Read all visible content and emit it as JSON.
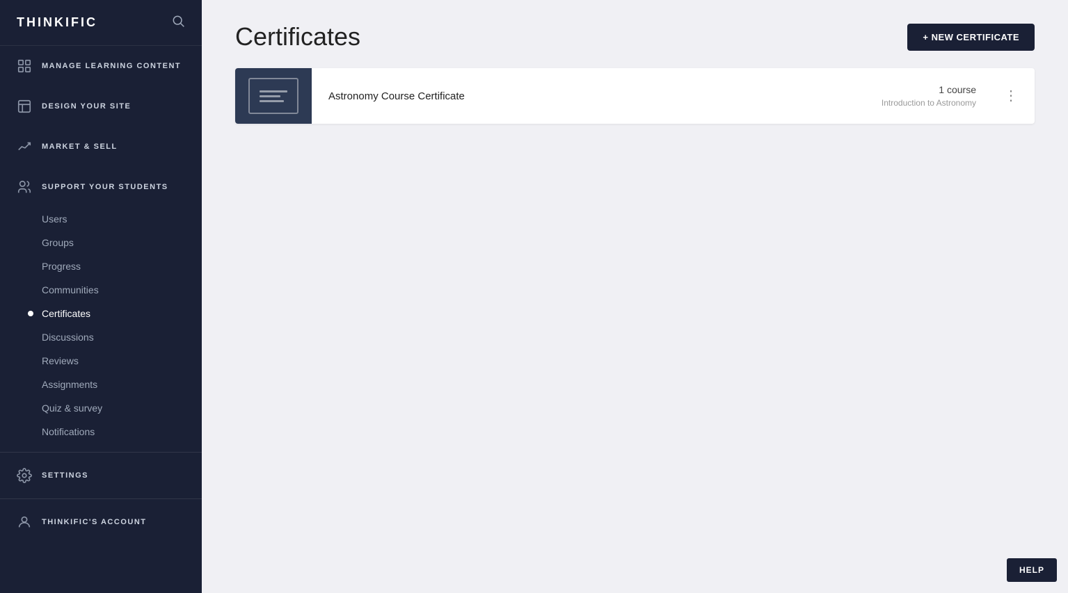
{
  "app": {
    "logo": "THINKIFIC"
  },
  "sidebar": {
    "sections": [
      {
        "id": "manage",
        "label": "MANAGE LEARNING CONTENT",
        "icon": "grid-icon",
        "subitems": []
      },
      {
        "id": "design",
        "label": "DESIGN YOUR SITE",
        "icon": "layout-icon",
        "subitems": []
      },
      {
        "id": "market",
        "label": "MARKET & SELL",
        "icon": "chart-icon",
        "subitems": []
      },
      {
        "id": "support",
        "label": "SUPPORT YOUR STUDENTS",
        "icon": "users-icon",
        "subitems": [
          {
            "id": "users",
            "label": "Users",
            "active": false
          },
          {
            "id": "groups",
            "label": "Groups",
            "active": false
          },
          {
            "id": "progress",
            "label": "Progress",
            "active": false
          },
          {
            "id": "communities",
            "label": "Communities",
            "active": false
          },
          {
            "id": "certificates",
            "label": "Certificates",
            "active": true
          },
          {
            "id": "discussions",
            "label": "Discussions",
            "active": false
          },
          {
            "id": "reviews",
            "label": "Reviews",
            "active": false
          },
          {
            "id": "assignments",
            "label": "Assignments",
            "active": false
          },
          {
            "id": "quiz-survey",
            "label": "Quiz & survey",
            "active": false
          },
          {
            "id": "notifications",
            "label": "Notifications",
            "active": false
          }
        ]
      }
    ],
    "settings_label": "SETTINGS",
    "account_label": "THINKIFIC'S ACCOUNT"
  },
  "page": {
    "title": "Certificates",
    "new_cert_button": "+ NEW CERTIFICATE"
  },
  "certificates": [
    {
      "id": 1,
      "name": "Astronomy Course Certificate",
      "course_count": "1 course",
      "course_name": "Introduction to Astronomy"
    }
  ],
  "help_button": "HELP"
}
